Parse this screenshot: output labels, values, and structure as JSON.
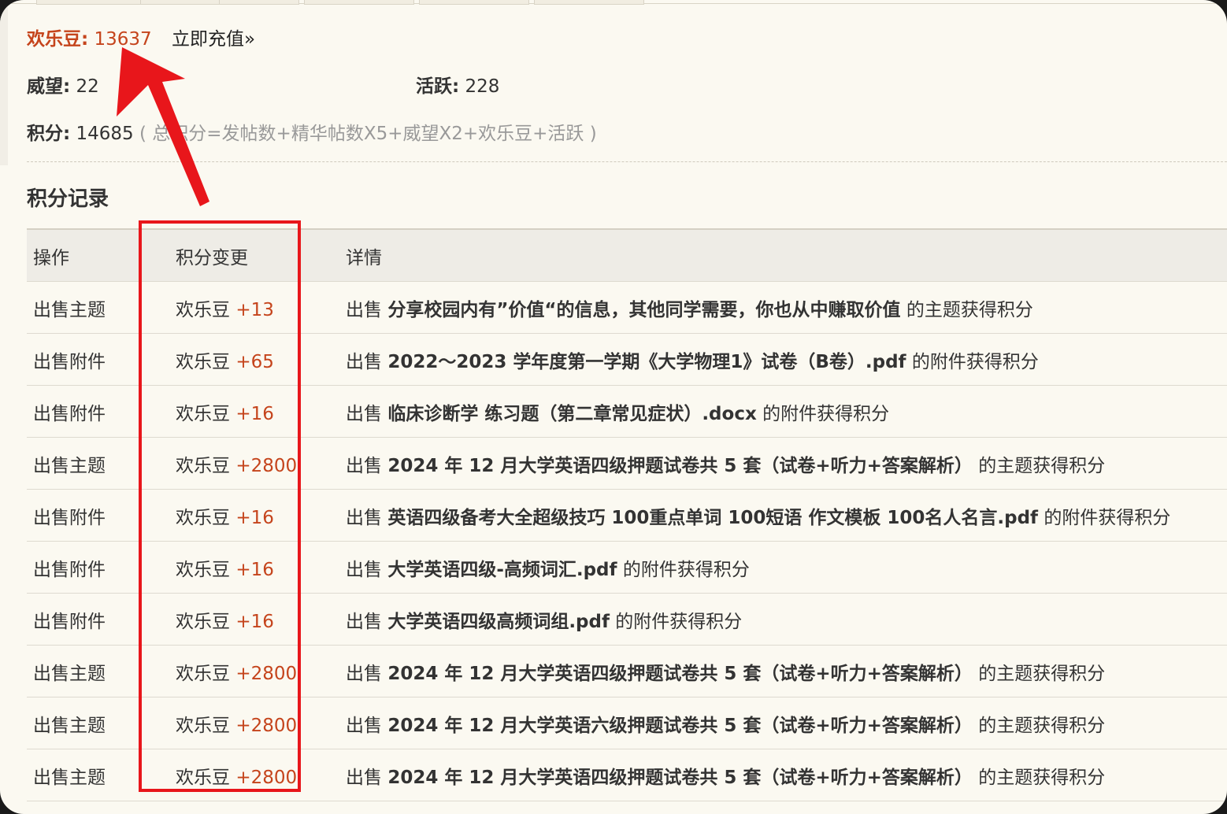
{
  "stats": {
    "credit_label": "欢乐豆:",
    "credit_value": "13637",
    "recharge_link": "立即充值»",
    "prestige_label": "威望:",
    "prestige_value": "22",
    "activity_label": "活跃:",
    "activity_value": "228",
    "points_label": "积分:",
    "points_value": "14685",
    "points_formula": "( 总积分=发帖数+精华帖数X5+威望X2+欢乐豆+活跃 )"
  },
  "section_title": "积分记录",
  "table": {
    "headers": [
      "操作",
      "积分变更",
      "详情"
    ],
    "rows": [
      {
        "action": "出售主题",
        "unit": "欢乐豆",
        "change": "+13",
        "prefix": "出售",
        "subject": "分享校园内有”价值“的信息，其他同学需要，你也从中赚取价值",
        "suffix": "的主题获得积分"
      },
      {
        "action": "出售附件",
        "unit": "欢乐豆",
        "change": "+65",
        "prefix": "出售",
        "subject": "2022～2023 学年度第一学期《大学物理1》试卷（B卷）.pdf",
        "suffix": "的附件获得积分"
      },
      {
        "action": "出售附件",
        "unit": "欢乐豆",
        "change": "+16",
        "prefix": "出售",
        "subject": "临床诊断学 练习题（第二章常见症状）.docx",
        "suffix": "的附件获得积分"
      },
      {
        "action": "出售主题",
        "unit": "欢乐豆",
        "change": "+2800",
        "prefix": "出售",
        "subject": "2024 年 12 月大学英语四级押题试卷共 5 套（试卷+听力+答案解析）",
        "suffix": "的主题获得积分"
      },
      {
        "action": "出售附件",
        "unit": "欢乐豆",
        "change": "+16",
        "prefix": "出售",
        "subject": "英语四级备考大全超级技巧 100重点单词 100短语 作文模板 100名人名言.pdf",
        "suffix": "的附件获得积分"
      },
      {
        "action": "出售附件",
        "unit": "欢乐豆",
        "change": "+16",
        "prefix": "出售",
        "subject": "大学英语四级-高频词汇.pdf",
        "suffix": "的附件获得积分"
      },
      {
        "action": "出售附件",
        "unit": "欢乐豆",
        "change": "+16",
        "prefix": "出售",
        "subject": "大学英语四级高频词组.pdf",
        "suffix": "的附件获得积分"
      },
      {
        "action": "出售主题",
        "unit": "欢乐豆",
        "change": "+2800",
        "prefix": "出售",
        "subject": "2024 年 12 月大学英语四级押题试卷共 5 套（试卷+听力+答案解析）",
        "suffix": "的主题获得积分"
      },
      {
        "action": "出售主题",
        "unit": "欢乐豆",
        "change": "+2800",
        "prefix": "出售",
        "subject": "2024 年 12 月大学英语六级押题试卷共 5 套（试卷+听力+答案解析）",
        "suffix": "的主题获得积分"
      },
      {
        "action": "出售主题",
        "unit": "欢乐豆",
        "change": "+2800",
        "prefix": "出售",
        "subject": "2024 年 12 月大学英语四级押题试卷共 5 套（试卷+听力+答案解析）",
        "suffix": "的主题获得积分"
      }
    ]
  },
  "annotation": {
    "color": "#e8161b",
    "arrow_icon": "arrow-up-left-icon"
  }
}
